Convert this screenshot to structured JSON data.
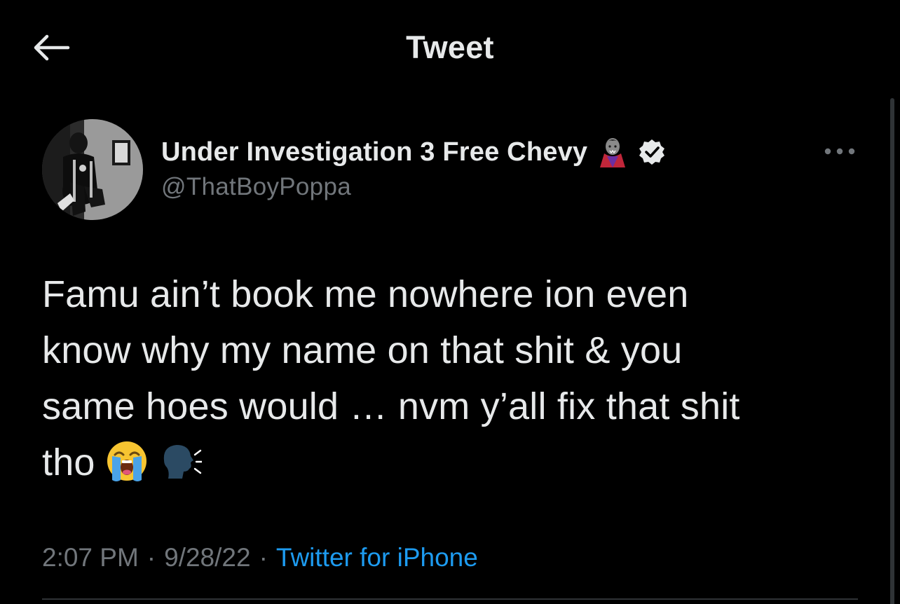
{
  "header": {
    "title": "Tweet",
    "back_icon": "arrow-left-icon"
  },
  "author": {
    "display_name": "Under Investigation 3 Free Chevy",
    "name_emoji": "vampire-emoji",
    "verified": true,
    "handle": "@ThatBoyPoppa"
  },
  "tweet": {
    "lines": [
      "Famu ain’t book me nowhere ion even",
      "know why my name on that shit & you",
      "same hoes would … nvm y’all fix that shit",
      "tho"
    ],
    "trailing_emojis": [
      "loudly-crying-face-emoji",
      "speaking-head-emoji"
    ]
  },
  "meta": {
    "time": "2:07 PM",
    "separator": "·",
    "date": "9/28/22",
    "source": "Twitter for iPhone"
  },
  "colors": {
    "background": "#000000",
    "text_primary": "#e7e9ea",
    "text_secondary": "#71767b",
    "accent": "#1d9bf0"
  }
}
